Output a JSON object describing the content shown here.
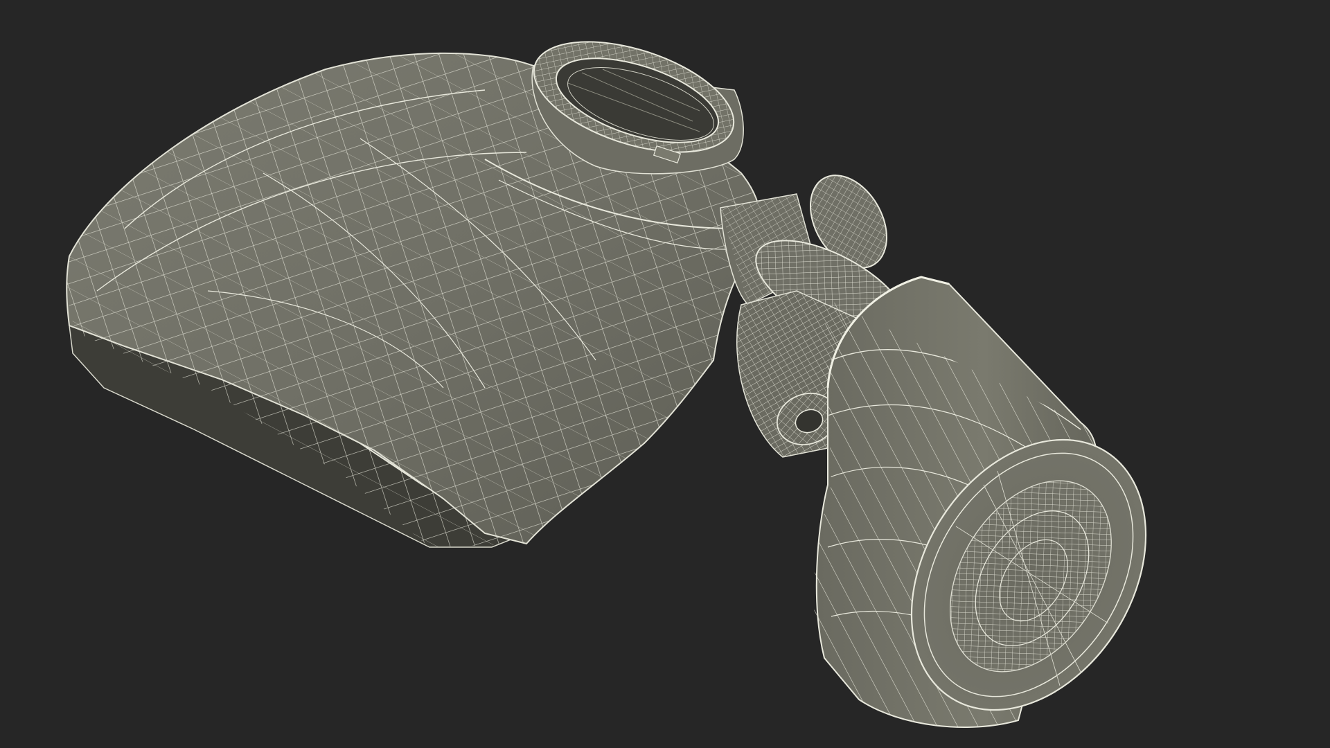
{
  "scene": {
    "subject": "3d-wireframe-model",
    "colors": {
      "background": "#262626",
      "surface": "#6f6f64",
      "surface_dark": "#4c4c44",
      "surface_light": "#7d7d71",
      "interior": "#3a3a35",
      "wire": "#e8e8dc",
      "wire_faint": "#cfcfc2"
    }
  }
}
